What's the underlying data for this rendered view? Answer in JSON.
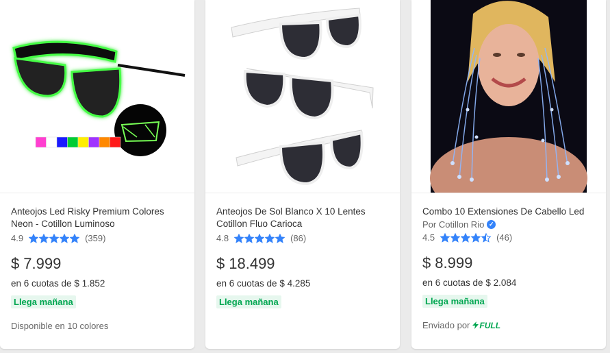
{
  "products": [
    {
      "title": "Anteojos Led Risky Premium Colores Neon - Cotillon Luminoso",
      "rating": "4.9",
      "stars": [
        1,
        1,
        1,
        1,
        1
      ],
      "reviews": "(359)",
      "currency": "$",
      "price": "7.999",
      "installments": "en 6 cuotas de $ 1.852",
      "delivery_badge": "Llega mañana",
      "extra": "Disponible en 10 colores"
    },
    {
      "title": "Anteojos De Sol Blanco X 10 Lentes Cotillon Fluo Carioca",
      "rating": "4.8",
      "stars": [
        1,
        1,
        1,
        1,
        1
      ],
      "reviews": "(86)",
      "currency": "$",
      "price": "18.499",
      "installments": "en 6 cuotas de $ 4.285",
      "delivery_badge": "Llega mañana"
    },
    {
      "title": "Combo 10 Extensiones De Cabello Led",
      "seller": "Por Cotillon Rio",
      "rating": "4.5",
      "stars": [
        1,
        1,
        1,
        1,
        0.5
      ],
      "reviews": "(46)",
      "currency": "$",
      "price": "8.999",
      "installments": "en 6 cuotas de $ 2.084",
      "delivery_badge": "Llega mañana",
      "shipping_prefix": "Enviado por",
      "shipping_brand": "FULL"
    }
  ],
  "colors": {
    "star": "#3483fa",
    "green": "#00a650",
    "badge_bg": "#e6f7ee"
  },
  "swatch_colors": [
    "#ff3fd0",
    "#ffffff",
    "#1a1aff",
    "#00cc33",
    "#ffee00",
    "#a033ff",
    "#ff8800",
    "#ff1a1a"
  ]
}
